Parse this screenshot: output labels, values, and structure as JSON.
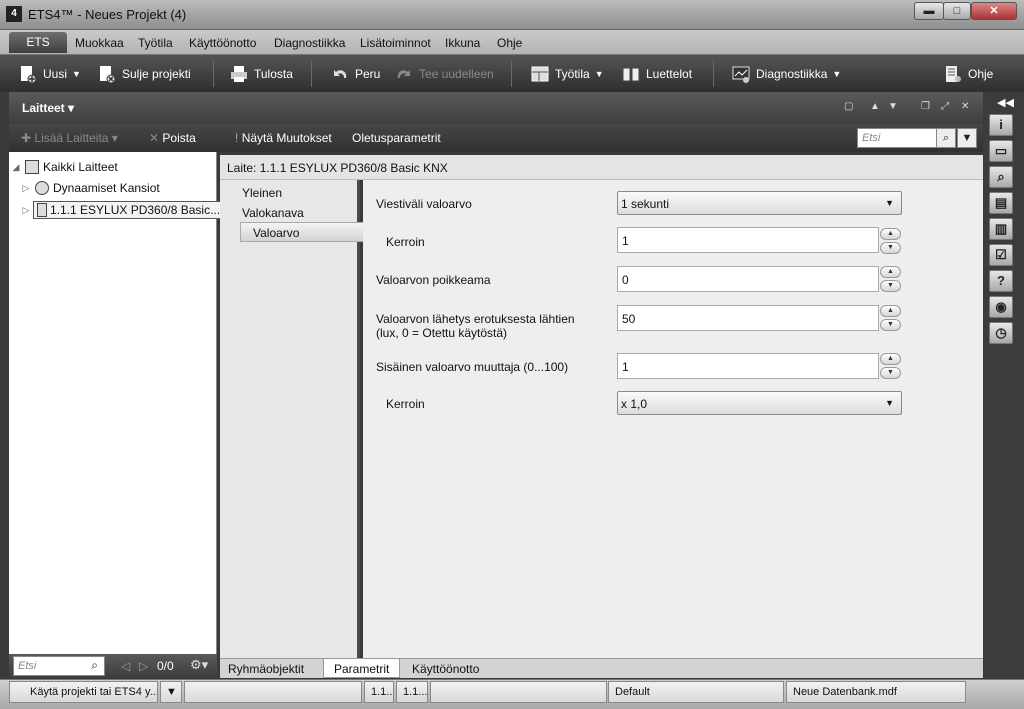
{
  "window": {
    "title": "ETS4™ - Neues Projekt (4)",
    "logo": "4"
  },
  "menu": {
    "ets": "ETS",
    "items": [
      "Muokkaa",
      "Työtila",
      "Käyttöönotto",
      "Diagnostiikka",
      "Lisätoiminnot",
      "Ikkuna",
      "Ohje"
    ]
  },
  "toolbar": {
    "new": "Uusi",
    "close_project": "Sulje projekti",
    "print": "Tulosta",
    "undo": "Peru",
    "redo": "Tee uudelleen",
    "workspace": "Työtila",
    "catalogs": "Luettelot",
    "diagnostics": "Diagnostiikka",
    "help": "Ohje"
  },
  "panel": {
    "title": "Laitteet"
  },
  "subtoolbar": {
    "add_devices": "Lisää Laitteita",
    "delete": "Poista",
    "show_changes": "Näytä Muutokset",
    "default_params": "Oletusparametrit",
    "search_placeholder": "Etsi"
  },
  "tree": {
    "all_devices": "Kaikki Laitteet",
    "dynamic_folders": "Dynaamiset Kansiot",
    "device": "1.1.1  ESYLUX PD360/8 Basic..."
  },
  "left_footer": {
    "search_placeholder": "Etsi",
    "pager": "0/0"
  },
  "device_header": "Laite: 1.1.1  ESYLUX PD360/8 Basic KNX",
  "nav": {
    "items": [
      "Yleinen",
      "Valokanava",
      "Valoarvo"
    ],
    "active": "Valoarvo"
  },
  "params": {
    "send_interval_label": "Viestiväli valoarvo",
    "send_interval_value": "1 sekunti",
    "factor1_label": "Kerroin",
    "factor1_value": "1",
    "offset_label": "Valoarvon poikkeama",
    "offset_value": "0",
    "send_diff_label_1": "Valoarvon lähetys erotuksesta lähtien",
    "send_diff_label_2": " (lux, 0 = Otettu käytöstä)",
    "send_diff_value": "50",
    "internal_modifier_label": "Sisäinen valoarvo muuttaja (0...100)",
    "internal_modifier_value": "1",
    "factor2_label": "Kerroin",
    "factor2_value": "x 1,0"
  },
  "tabs": [
    "Ryhmäobjektit",
    "Parametrit",
    "Käyttöönotto"
  ],
  "active_tab": "Parametrit",
  "status": {
    "hint": "Käytä projekti tai ETS4 y...",
    "cell1": "1.1...",
    "cell2": "1.1...",
    "profile": "Default",
    "database": "Neue Datenbank.mdf"
  },
  "dock_icons": [
    "info-icon",
    "folder-icon",
    "search-icon",
    "layout-icon",
    "book-icon",
    "checklist-icon",
    "help-icon",
    "media-icon",
    "clock-icon"
  ]
}
